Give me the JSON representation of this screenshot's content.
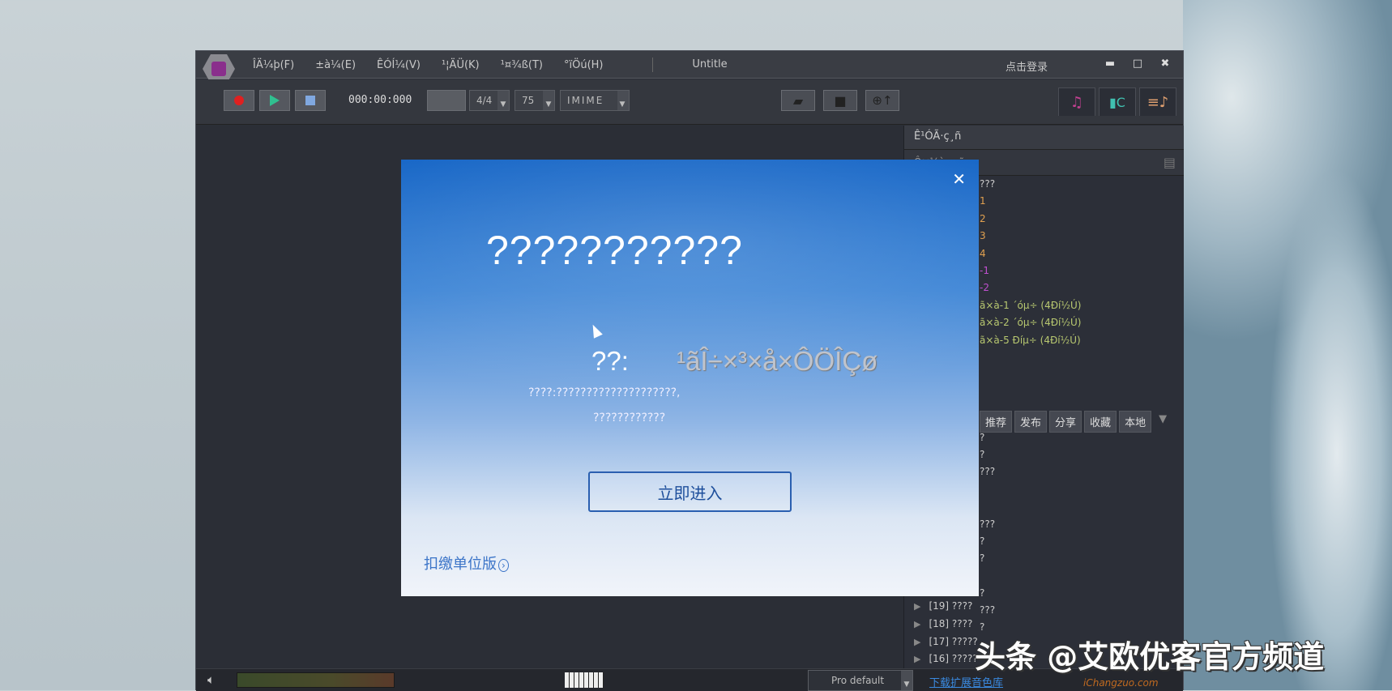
{
  "menu": {
    "items": [
      "ÎÄ¼þ(F)",
      "±à¼­(E)",
      "ÊÓÍ¼(V)",
      "¹¦ÄÜ(K)",
      "¹¤¾ß(T)",
      "°ïÖú(H)"
    ],
    "title": "Untitle",
    "login": "点击登录"
  },
  "toolbar": {
    "time": "000:00:000",
    "beat": "4/4",
    "tempo": "75",
    "input": "IMIME"
  },
  "panel": {
    "header": "Ê¹ÓÃ·ç¸ñ",
    "subheader": "Ô×¼à·ç¸ñ",
    "top_items": [
      {
        "t": "???",
        "c": "#cccccc"
      },
      {
        "t": "1",
        "c": "#e0a050"
      },
      {
        "t": "2",
        "c": "#e0a050"
      },
      {
        "t": "3",
        "c": "#e0a050"
      },
      {
        "t": "4",
        "c": "#e0a050"
      },
      {
        "t": "-1",
        "c": "#c050d0"
      },
      {
        "t": "-2",
        "c": "#c050d0"
      },
      {
        "t": "ã×à-1 ´óµ÷ (4Ðí½Ú)",
        "c": "#b8c870"
      },
      {
        "t": "ã×à-2 ´óµ÷ (4Ðí½Ú)",
        "c": "#b8c870"
      },
      {
        "t": "ã×à-5 Ðíµ÷ (4Ðí½Ú)",
        "c": "#b8c870"
      }
    ],
    "tabs": [
      "推荐",
      "发布",
      "分享",
      "收藏",
      "本地"
    ],
    "mid_items": [
      "?",
      "?",
      "???",
      "???",
      "?",
      "?",
      "?",
      "???",
      "?"
    ],
    "bottom_items": [
      "[19] ????",
      "[18] ????",
      "[17] ?????",
      "[16] ?????"
    ]
  },
  "bottom": {
    "preset": "Pro default",
    "download_link": "下载扩展音色库",
    "site": "iChangzuo.com"
  },
  "dialog": {
    "title": "???????????",
    "label": "??:",
    "value": "¹ãÎ÷×³×å×ÔÖÎÇø",
    "desc1": "????:????????????????????,",
    "desc2": "????????????",
    "enter_button": "立即进入",
    "link": "扣缴单位版"
  },
  "watermark": "头条 @艾欧优客官方频道"
}
